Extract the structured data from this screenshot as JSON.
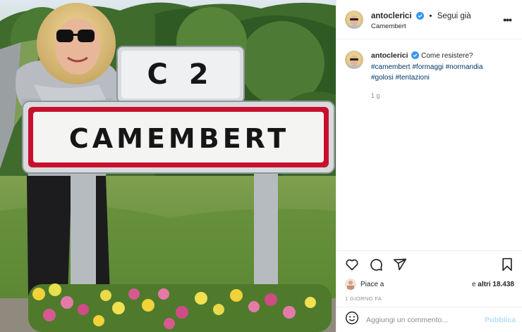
{
  "post": {
    "author": "antoclerici",
    "follow_label": "Segui già",
    "location": "Camembert",
    "more_label": "•••",
    "caption": {
      "text": "Come resistere?",
      "hashtags": [
        "#camembert",
        "#formaggi",
        "#normandia",
        "#golosi",
        "#tentazioni"
      ],
      "time": "1 g"
    },
    "likes": {
      "prefix": "Piace a",
      "connector": "e",
      "others": "altri 18.438"
    },
    "time_ago": "1 GIORNO FA",
    "comment": {
      "placeholder": "Aggiungi un commento...",
      "publish_label": "Pubblica"
    },
    "colors": {
      "link": "#00376b",
      "publish": "#b2dffc",
      "verified": "#3897f0",
      "sign_border": "#c8102e"
    },
    "icons": [
      "emoji-icon",
      "heart-icon",
      "comment-icon",
      "share-icon",
      "bookmark-icon",
      "verified-icon",
      "more-options-icon"
    ]
  },
  "photo": {
    "sign_top": "C 2",
    "sign_main": "CAMEMBERT"
  }
}
